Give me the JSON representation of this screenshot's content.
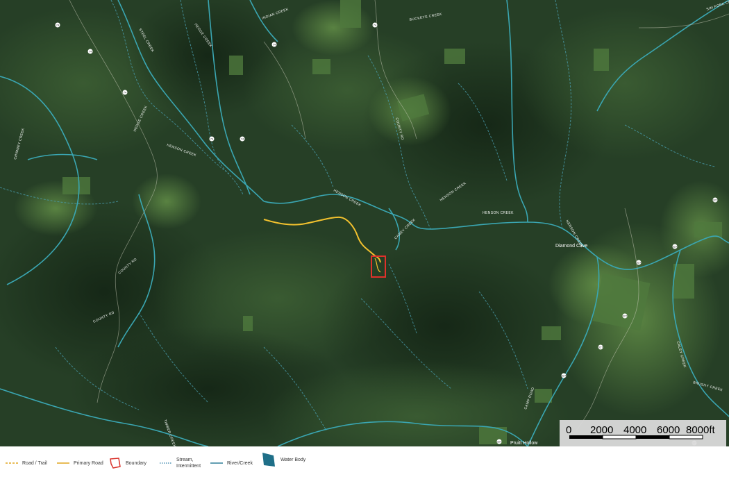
{
  "map": {
    "stream_labels": [
      "INDIAN CREEK",
      "BUCKEYE CREEK",
      "SIM FORK CREEK",
      "STEEL CREEK",
      "HEDGE CREEK",
      "HENSON CREEK",
      "HENSON CREEK",
      "HENSON CREEK",
      "HENSON CREEK",
      "HERSON CREEK",
      "CHIMNEY CREEK",
      "HEDGE CREEK",
      "COUNTY RD",
      "COUNTY RD",
      "COUNTY RD",
      "CANEY CREEK",
      "BRUSHY CREEK",
      "CAMP ROAD",
      "TIMBER CREEK",
      "CALEY CREEK"
    ],
    "place_labels": [
      "Diamond Cave",
      "Pruitt Hollow"
    ],
    "road_shields": [
      "74",
      "74",
      "74",
      "74",
      "74",
      "74",
      "74",
      "327",
      "327",
      "327",
      "327",
      "327",
      "327",
      "327",
      "327"
    ],
    "colors": {
      "river": "#3aa6b2",
      "stream": "#4a9fb0",
      "primary_road": "#f2c12e",
      "boundary": "#e0312b",
      "terrain_dark": "#1e3320",
      "terrain_mid": "#2e4a2c",
      "field": "#4f7a3e"
    }
  },
  "scale_bar": {
    "labels": [
      "0",
      "2000",
      "4000",
      "6000",
      "8000ft"
    ]
  },
  "legend": {
    "road_trail": {
      "label": "Road / Trail",
      "icon": "dashed-road-icon",
      "color": "#e1a61e"
    },
    "primary_road": {
      "label": "Primary Road",
      "icon": "solid-road-icon",
      "color": "#e1a61e"
    },
    "boundary": {
      "label": "Boundary",
      "icon": "boundary-polygon-icon",
      "color": "#d9322b"
    },
    "stream": {
      "label": "Stream, Intermittent",
      "icon": "dotted-stream-icon",
      "color": "#2e7fa8"
    },
    "river": {
      "label": "River/Creek",
      "icon": "river-line-icon",
      "color": "#2f7f99"
    },
    "water_body": {
      "label": "Water Body",
      "icon": "water-body-icon",
      "color": "#1f6f88"
    }
  }
}
